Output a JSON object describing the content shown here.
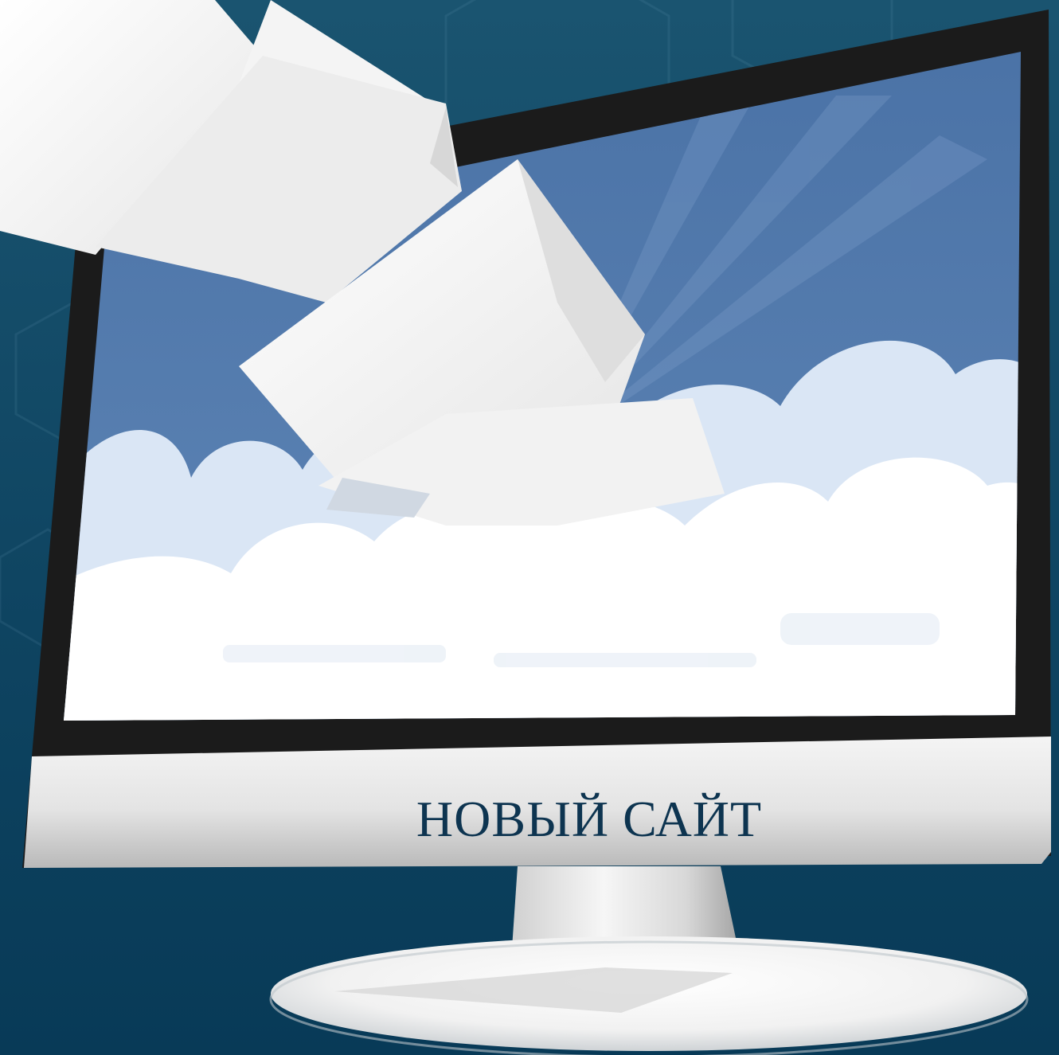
{
  "caption": "НОВЫЙ САЙТ"
}
